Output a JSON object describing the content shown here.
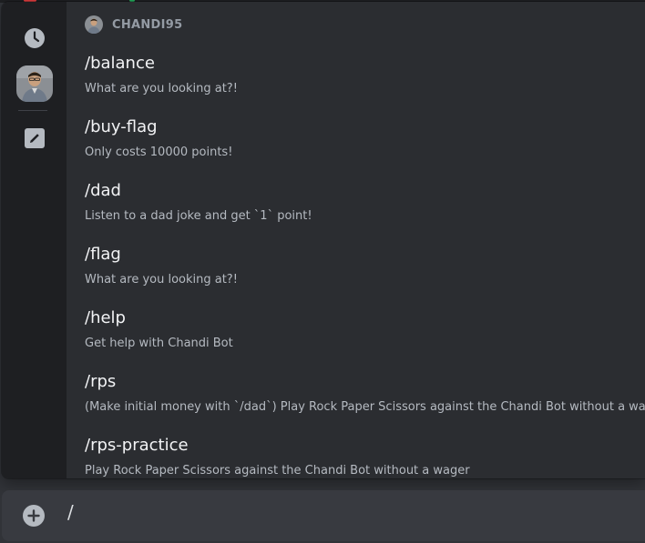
{
  "popup": {
    "rail": {
      "items": [
        {
          "name": "recent",
          "icon": "clock-icon"
        },
        {
          "name": "bot-app",
          "icon": "bot-avatar"
        },
        {
          "name": "built-in",
          "icon": "pencil-icon"
        }
      ]
    },
    "section_title": "CHANDI95",
    "commands": [
      {
        "name": "/balance",
        "description": "What are you looking at?!"
      },
      {
        "name": "/buy-flag",
        "description": "Only costs 10000 points!"
      },
      {
        "name": "/dad",
        "description": "Listen to a dad joke and get `1` point!"
      },
      {
        "name": "/flag",
        "description": "What are you looking at?!"
      },
      {
        "name": "/help",
        "description": "Get help with Chandi Bot"
      },
      {
        "name": "/rps",
        "description": "(Make initial money with `/dad`) Play Rock Paper Scissors against the Chandi Bot without a wager"
      },
      {
        "name": "/rps-practice",
        "description": "Play Rock Paper Scissors against the Chandi Bot without a wager"
      }
    ]
  },
  "composer": {
    "add_icon": "plus-circle-icon",
    "value": "/"
  },
  "colors": {
    "background": "#313338",
    "popup": "#2b2d31",
    "rail": "#1e1f22",
    "input": "#383a40",
    "text_primary": "#f2f3f5",
    "text_muted": "#b5bac1",
    "header": "#949ba4"
  }
}
